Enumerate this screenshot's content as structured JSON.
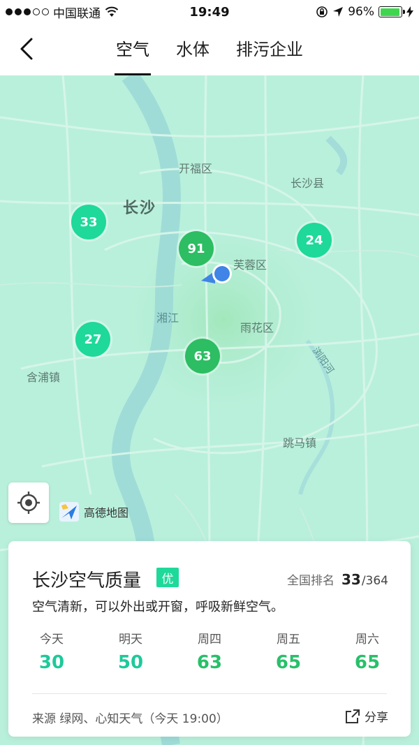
{
  "status_bar": {
    "carrier": "中国联通",
    "time": "19:49",
    "battery_pct": "96%",
    "battery_level": 0.96
  },
  "nav": {
    "tabs": [
      {
        "label": "空气",
        "active": true
      },
      {
        "label": "水体",
        "active": false
      },
      {
        "label": "排污企业",
        "active": false
      }
    ]
  },
  "map": {
    "city_label": "长沙",
    "districts": [
      "开福区",
      "长沙县",
      "芙蓉区",
      "雨花区",
      "含浦镇",
      "跳马镇"
    ],
    "river": "湘江",
    "river2": "浏阳河",
    "markers": [
      {
        "value": "33",
        "level": "light"
      },
      {
        "value": "91",
        "level": "mid"
      },
      {
        "value": "24",
        "level": "light"
      },
      {
        "value": "27",
        "level": "light"
      },
      {
        "value": "63",
        "level": "mid"
      }
    ],
    "provider": "高德地图"
  },
  "card": {
    "title": "长沙空气质量",
    "badge": "优",
    "rank_label": "全国排名",
    "rank": "33",
    "rank_total": "/364",
    "description": "空气清新，可以外出或开窗，呼吸新鲜空气。",
    "forecast": [
      {
        "day": "今天",
        "value": "30"
      },
      {
        "day": "明天",
        "value": "50"
      },
      {
        "day": "周四",
        "value": "63"
      },
      {
        "day": "周五",
        "value": "65"
      },
      {
        "day": "周六",
        "value": "65"
      }
    ],
    "source": "来源 绿网、心知天气（今天 19:00）",
    "share_label": "分享"
  },
  "colors": {
    "map_bg": "#b9f0dc",
    "marker_light": "#1ed999",
    "marker_mid": "#2dbd63",
    "value_green": "#1ec99a"
  }
}
